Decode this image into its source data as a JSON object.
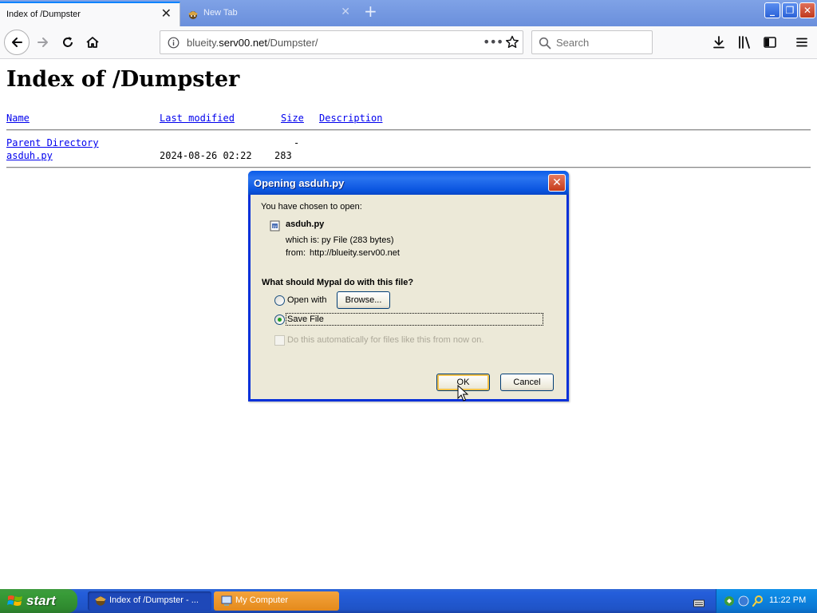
{
  "browser": {
    "tabs": [
      {
        "title": "Index of /Dumpster"
      },
      {
        "title": "New Tab"
      }
    ],
    "url_prefix": "blueity.",
    "url_host": "serv00.net",
    "url_path": "/Dumpster/",
    "search_placeholder": "Search"
  },
  "page": {
    "title": "Index of /Dumpster",
    "columns": {
      "name": "Name",
      "last_modified": "Last modified",
      "size": "Size",
      "description": "Description"
    },
    "rows": [
      {
        "name": "Parent Directory",
        "modified": "",
        "size": "-"
      },
      {
        "name": "asduh.py",
        "modified": "2024-08-26 02:22",
        "size": "283"
      }
    ]
  },
  "dialog": {
    "title": "Opening asduh.py",
    "chosen_text": "You have chosen to open:",
    "filename": "asduh.py",
    "which_is_label": "which is:",
    "which_is_value": "py File (283 bytes)",
    "from_label": "from:",
    "from_value": "http://blueity.serv00.net",
    "question": "What should Mypal do with this file?",
    "open_with_label": "Open with",
    "browse_label": "Browse...",
    "save_file_label": "Save File",
    "auto_label": "Do this automatically for files like this from now on.",
    "ok_label": "OK",
    "cancel_label": "Cancel",
    "selected_option": "save_file"
  },
  "taskbar": {
    "start_label": "start",
    "tasks": [
      {
        "label": "Index of /Dumpster - ..."
      },
      {
        "label": "My Computer"
      }
    ],
    "clock": "11:22 PM"
  }
}
